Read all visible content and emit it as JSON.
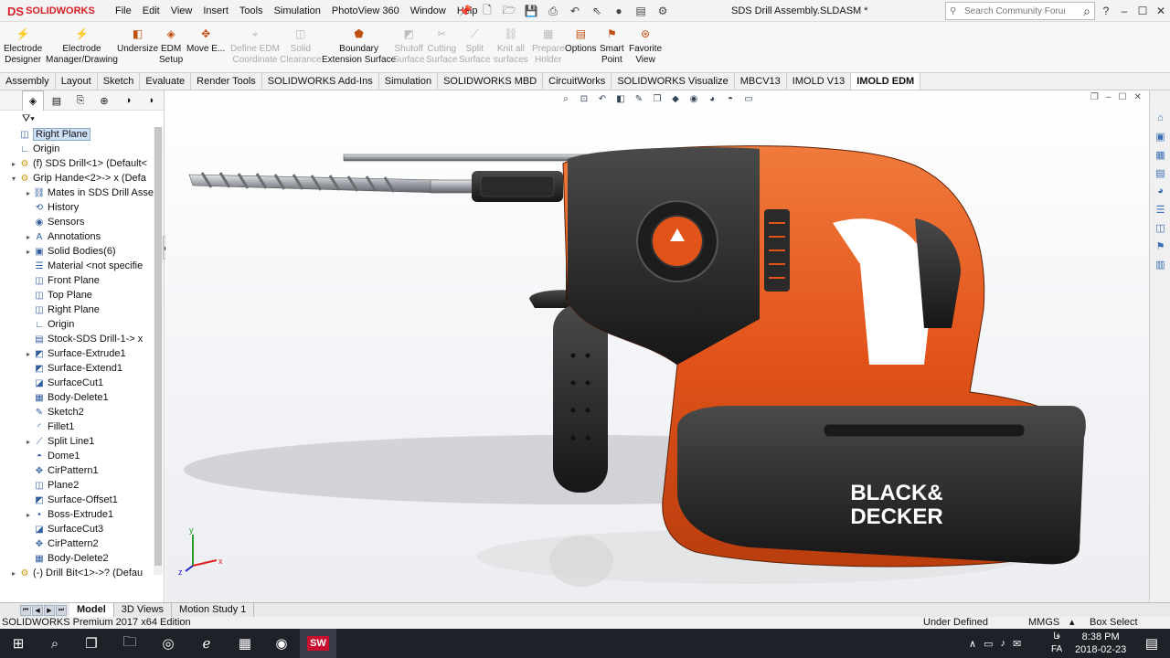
{
  "app": {
    "logo_mark": "DS",
    "logo_text": "SOLIDWORKS",
    "document_title": "SDS Drill Assembly.SLDASM *"
  },
  "menus": [
    "File",
    "Edit",
    "View",
    "Insert",
    "Tools",
    "Simulation",
    "PhotoView 360",
    "Window",
    "Help"
  ],
  "quick_access_icons": [
    "pin-icon",
    "new-icon",
    "open-icon",
    "save-icon",
    "print-icon",
    "undo-icon",
    "select-icon",
    "rebuild-icon",
    "file-properties-icon",
    "options-icon"
  ],
  "search": {
    "placeholder": "Search Community Forum"
  },
  "window_controls": {
    "help": "?",
    "minimize": "–",
    "maximize": "☐",
    "close": "✕"
  },
  "ribbon": [
    {
      "label1": "Electrode",
      "label2": "Designer",
      "enabled": true
    },
    {
      "label1": "Electrode",
      "label2": "Manager/Drawing",
      "enabled": true
    },
    {
      "label1": "Undersize",
      "label2": "",
      "enabled": true
    },
    {
      "label1": "EDM",
      "label2": "Setup",
      "enabled": true
    },
    {
      "label1": "Move E...",
      "label2": "",
      "enabled": true
    },
    {
      "label1": "Define EDM",
      "label2": "Coordinate",
      "enabled": false
    },
    {
      "label1": "Solid",
      "label2": "Clearance",
      "enabled": false
    },
    {
      "label1": "Boundary",
      "label2": "Extension Surface",
      "enabled": true
    },
    {
      "label1": "Shutoff",
      "label2": "Surface",
      "enabled": false
    },
    {
      "label1": "Cutting",
      "label2": "Surface",
      "enabled": false
    },
    {
      "label1": "Split",
      "label2": "Surface",
      "enabled": false
    },
    {
      "label1": "Knit all",
      "label2": "surfaces",
      "enabled": false
    },
    {
      "label1": "Prepare",
      "label2": "Holder",
      "enabled": false
    },
    {
      "label1": "Options",
      "label2": "",
      "enabled": true
    },
    {
      "label1": "Smart",
      "label2": "Point",
      "enabled": true
    },
    {
      "label1": "Favorite",
      "label2": "View",
      "enabled": true
    }
  ],
  "tabs": [
    "Assembly",
    "Layout",
    "Sketch",
    "Evaluate",
    "Render Tools",
    "SOLIDWORKS Add-Ins",
    "Simulation",
    "SOLIDWORKS MBD",
    "CircuitWorks",
    "SOLIDWORKS Visualize",
    "MBCV13",
    "IMOLD V13",
    "IMOLD EDM"
  ],
  "active_tab": "IMOLD EDM",
  "tree": [
    {
      "label": "Right Plane",
      "icon": "plane-icon",
      "selected": true
    },
    {
      "label": "Origin",
      "icon": "origin-icon"
    },
    {
      "label": "(f) SDS Drill<1> (Default<",
      "icon": "part-icon",
      "arrow": "▸"
    },
    {
      "label": "Grip Hande<2>-> x (Defa",
      "icon": "part-icon",
      "arrow": "▾"
    },
    {
      "label": "Mates in SDS Drill Asse",
      "icon": "mates-icon",
      "arrow": "▸"
    },
    {
      "label": "History",
      "icon": "history-icon"
    },
    {
      "label": "Sensors",
      "icon": "sensors-icon"
    },
    {
      "label": "Annotations",
      "icon": "annotations-icon",
      "arrow": "▸"
    },
    {
      "label": "Solid Bodies(6)",
      "icon": "solid-bodies-icon",
      "arrow": "▸"
    },
    {
      "label": "Material <not specifie",
      "icon": "material-icon"
    },
    {
      "label": "Front Plane",
      "icon": "plane-icon"
    },
    {
      "label": "Top Plane",
      "icon": "plane-icon"
    },
    {
      "label": "Right Plane",
      "icon": "plane-icon"
    },
    {
      "label": "Origin",
      "icon": "origin-icon"
    },
    {
      "label": "Stock-SDS Drill-1-> x",
      "icon": "stock-icon"
    },
    {
      "label": "Surface-Extrude1",
      "icon": "surface-icon",
      "arrow": "▸"
    },
    {
      "label": "Surface-Extend1",
      "icon": "surface-icon"
    },
    {
      "label": "SurfaceCut1",
      "icon": "surface-cut-icon"
    },
    {
      "label": "Body-Delete1",
      "icon": "body-delete-icon"
    },
    {
      "label": "Sketch2",
      "icon": "sketch-icon"
    },
    {
      "label": "Fillet1",
      "icon": "fillet-icon"
    },
    {
      "label": "Split Line1",
      "icon": "split-line-icon",
      "arrow": "▸"
    },
    {
      "label": "Dome1",
      "icon": "dome-icon"
    },
    {
      "label": "CirPattern1",
      "icon": "pattern-icon"
    },
    {
      "label": "Plane2",
      "icon": "plane-icon"
    },
    {
      "label": "Surface-Offset1",
      "icon": "surface-icon"
    },
    {
      "label": "Boss-Extrude1",
      "icon": "extrude-icon",
      "arrow": "▸"
    },
    {
      "label": "SurfaceCut3",
      "icon": "surface-cut-icon"
    },
    {
      "label": "CirPattern2",
      "icon": "pattern-icon"
    },
    {
      "label": "Body-Delete2",
      "icon": "body-delete-icon"
    },
    {
      "label": "(-) Drill Bit<1>->? (Defau",
      "icon": "part-icon",
      "arrow": "▸"
    }
  ],
  "model": {
    "brand_line1": "BLACK&",
    "brand_line2": "DECKER",
    "colors": {
      "body": "#e2531a",
      "dark": "#2b2b2b",
      "chrome": "#b9bcc1"
    }
  },
  "axes": {
    "x": "x",
    "y": "y",
    "z": "z"
  },
  "bottom_tabs": [
    "Model",
    "3D Views",
    "Motion Study 1"
  ],
  "active_bottom_tab": "Model",
  "status": {
    "edition": "SOLIDWORKS Premium 2017 x64 Edition",
    "state": "Under Defined",
    "units": "MMGS",
    "units_arrow": "▴",
    "mode": "Box Select"
  },
  "taskbar": {
    "time": "8:38 PM",
    "date": "2018-02-23",
    "lang_top": "فا",
    "lang_bottom": "FA"
  }
}
